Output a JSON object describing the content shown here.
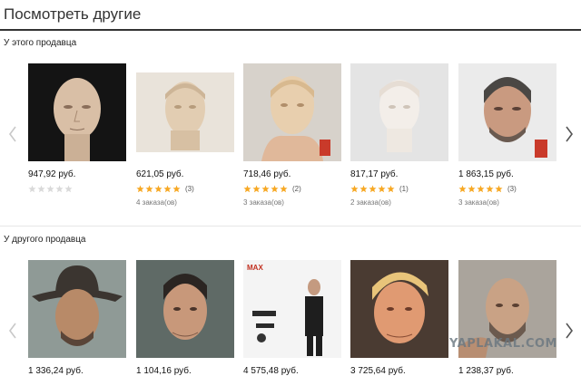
{
  "page_title": "Посмотреть другие",
  "watermark": "YAPLAKAL.COM",
  "colors": {
    "star_filled": "#f7a823",
    "star_empty": "#d9d9d9",
    "title_rule": "#333333"
  },
  "sections": [
    {
      "label": "У этого продавца",
      "prev_icon": "chevron-left-icon",
      "next_icon": "chevron-right-icon",
      "products": [
        {
          "image": "bald-head-sculpt-photo",
          "price": "947,92 руб.",
          "stars": 0,
          "review_count": "",
          "orders": ""
        },
        {
          "image": "unpainted-head-sculpt-photo",
          "price": "621,05 руб.",
          "stars": 5,
          "review_count": "(3)",
          "orders": "4 заказа(ов)"
        },
        {
          "image": "handheld-head-sculpt-photo",
          "price": "718,46 руб.",
          "stars": 5,
          "review_count": "(2)",
          "orders": "3 заказа(ов)"
        },
        {
          "image": "white-head-sculpt-photo",
          "price": "817,17 руб.",
          "stars": 5,
          "review_count": "(1)",
          "orders": "2 заказа(ов)"
        },
        {
          "image": "painted-head-sculpt-photo",
          "price": "1 863,15 руб.",
          "stars": 5,
          "review_count": "(3)",
          "orders": "3 заказа(ов)"
        }
      ]
    },
    {
      "label": "У другого продавца",
      "prev_icon": "chevron-left-icon",
      "next_icon": "chevron-right-icon",
      "products": [
        {
          "image": "cowboy-head-sculpt-photo",
          "price": "1 336,24 руб."
        },
        {
          "image": "dark-hair-head-sculpt-photo",
          "price": "1 104,16 руб."
        },
        {
          "image": "action-figure-set-photo",
          "price": "4 575,48 руб."
        },
        {
          "image": "blond-politician-head-photo",
          "price": "3 725,64 руб."
        },
        {
          "image": "bald-bearded-head-photo",
          "price": "1 238,37 руб."
        }
      ]
    }
  ]
}
